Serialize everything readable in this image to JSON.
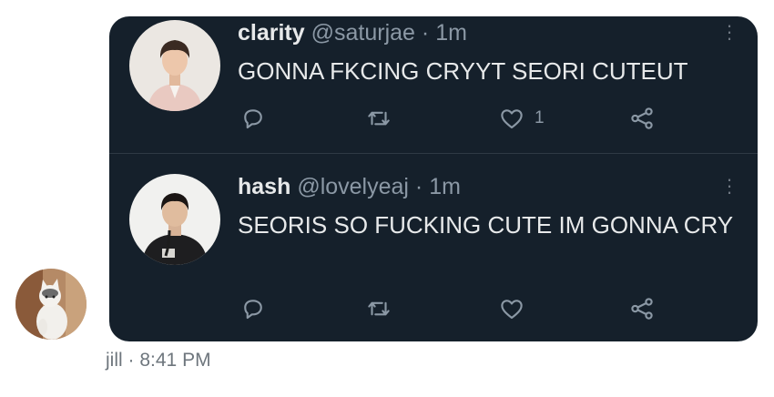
{
  "tweets": [
    {
      "display_name": "clarity",
      "handle": "@saturjae",
      "separator": "·",
      "time": "1m",
      "text": "GONNA FKCING CRYYT SEORI CUTEUT",
      "like_count": "1",
      "avatar_icon": "profile-photo"
    },
    {
      "display_name": "hash",
      "handle": "@lovelyeaj",
      "separator": "·",
      "time": "1m",
      "text": "SEORIS SO FUCKING CUTE IM GONNA CRY",
      "like_count": "",
      "avatar_icon": "profile-photo"
    }
  ],
  "message": {
    "sender": "jill",
    "separator": "·",
    "time": "8:41 PM",
    "avatar_icon": "cat-photo"
  },
  "colors": {
    "card_background": "#15202b",
    "primary_text": "#e7e9ea",
    "secondary_text": "#8b98a5",
    "divider": "#2f3a45"
  }
}
